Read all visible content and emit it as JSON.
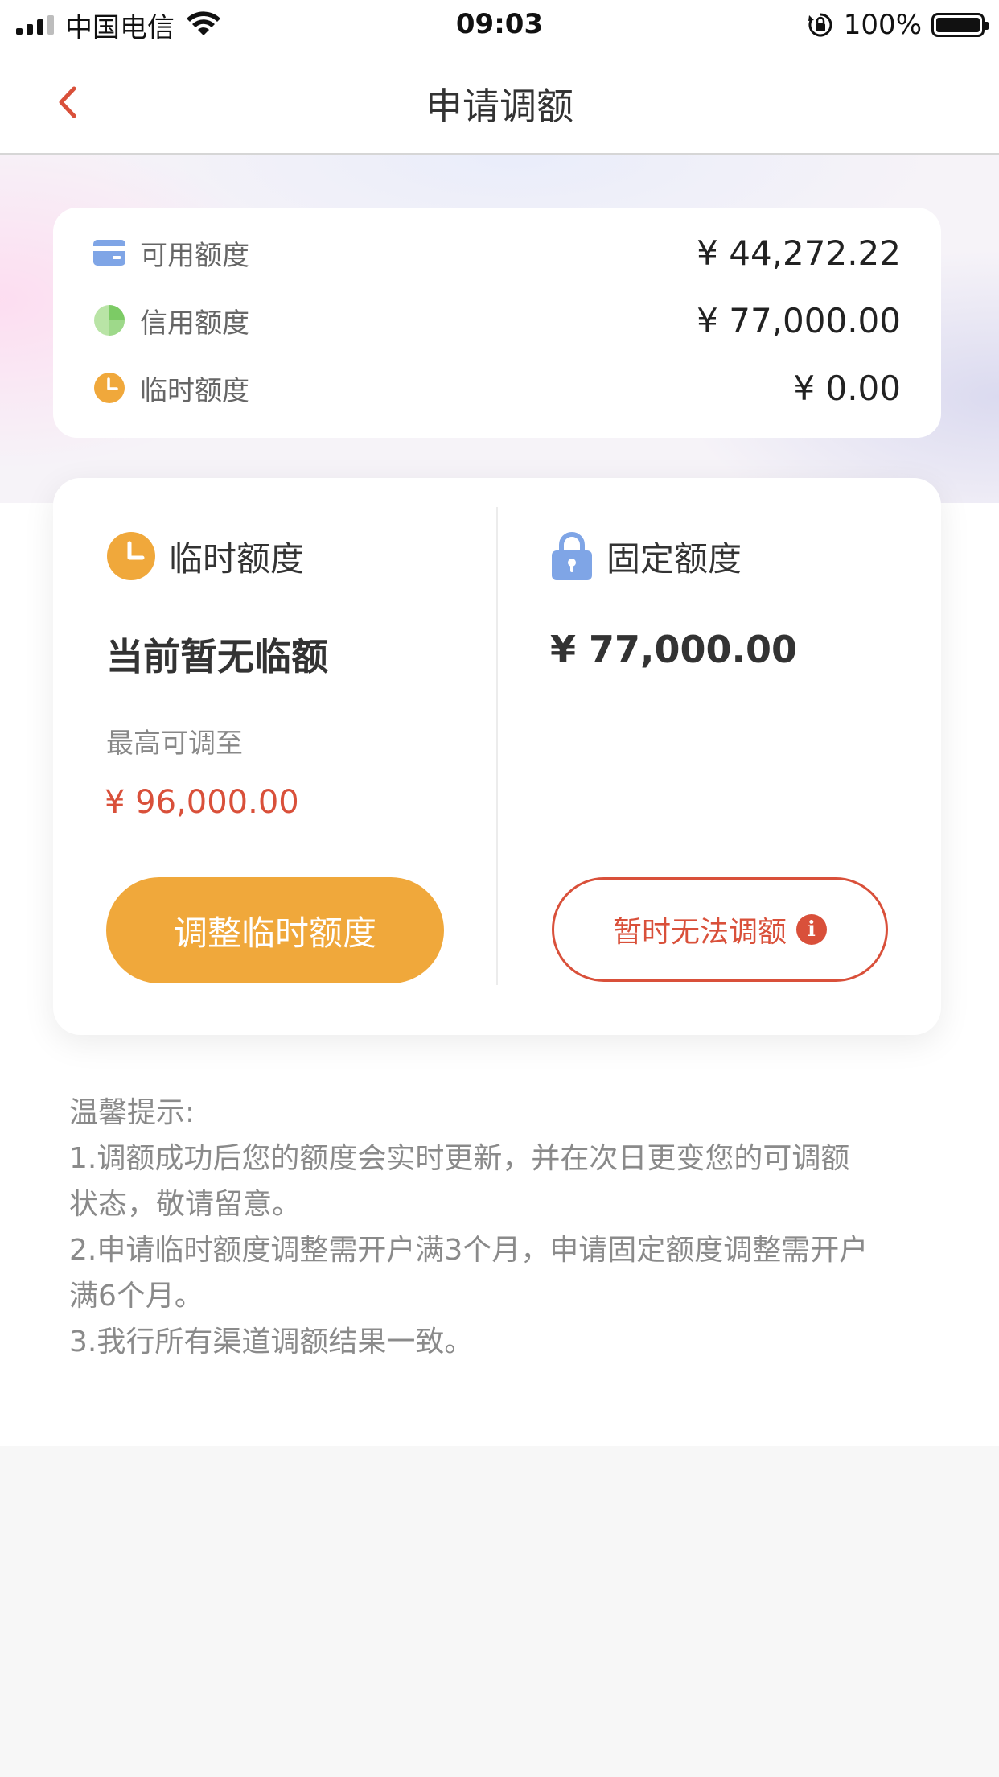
{
  "status_bar": {
    "carrier": "中国电信",
    "time": "09:03",
    "battery": "100%"
  },
  "nav": {
    "title": "申请调额",
    "back_icon": "chevron-left-icon",
    "accent": "#d9503a"
  },
  "summary": {
    "rows": [
      {
        "icon": "card-icon",
        "label": "可用额度",
        "value": "¥ 44,272.22"
      },
      {
        "icon": "pie-chart-icon",
        "label": "信用额度",
        "value": "¥ 77,000.00"
      },
      {
        "icon": "clock-icon",
        "label": "临时额度",
        "value": "¥ 0.00"
      }
    ]
  },
  "temp_quota": {
    "icon": "clock-icon",
    "header": "临时额度",
    "status": "当前暂无临额",
    "max_label": "最高可调至",
    "max_value": "¥ 96,000.00",
    "button": "调整临时额度",
    "button_color": "#f0a83b"
  },
  "fixed_quota": {
    "icon": "lock-icon",
    "header": "固定额度",
    "amount": "¥ 77,000.00",
    "button": "暂时无法调额",
    "info_icon": "info-icon",
    "button_color": "#d9503a"
  },
  "tips": {
    "lines": [
      "温馨提示:",
      "1.调额成功后您的额度会实时更新，并在次日更变您的可调额",
      "状态，敬请留意。",
      "2.申请临时额度调整需开户满3个月，申请固定额度调整需开户",
      "满6个月。",
      "3.我行所有渠道调额结果一致。"
    ]
  }
}
